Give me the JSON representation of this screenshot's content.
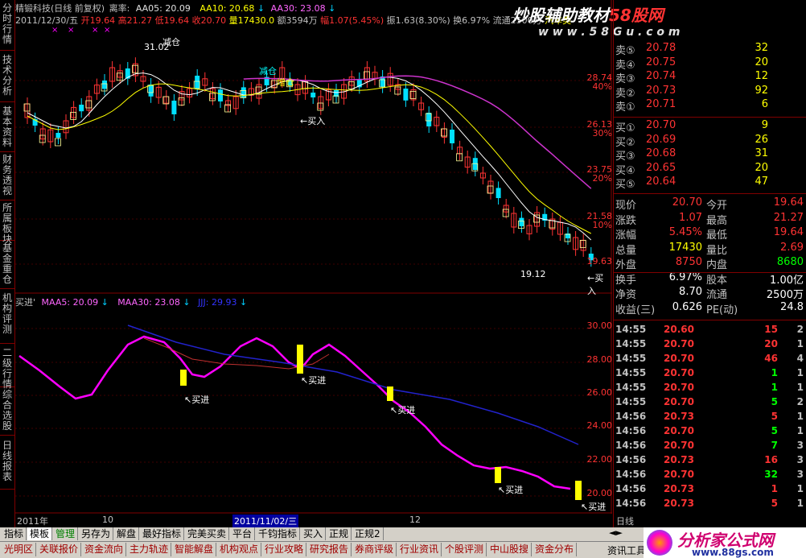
{
  "left_tabs": [
    "分时行情",
    "技术分析",
    "基本资料",
    "财务透视",
    "所属板块",
    "基金重仓",
    "机构评测",
    "二级行情",
    "综合选股",
    "日线报表"
  ],
  "header": {
    "stock": "精锻科技(日线 前复权)",
    "ind_label": "离率:",
    "aa05": "AA05: 20.09",
    "aa10": "AA10: 20.68",
    "aa30": "AA30: 23.08",
    "date": "2011/12/30/五",
    "open": "开19.64",
    "high": "高21.27",
    "low": "低19.64",
    "close": "收20.70",
    "vol": "量17430.0",
    "amt": "额3594万",
    "chg": "幅1.07(5.45%)",
    "amp": "振1.63(8.30%)",
    "turn": "换6.97%",
    "float": "流通2500万",
    "sector": "汽车类",
    "ad_text": "炒股辅助教材",
    "ad_site": "58股网",
    "ad_url": "w w w . 5 8 G u . c o m"
  },
  "price_axis": {
    "labels": [
      {
        "v": "28.74",
        "pct": "40%"
      },
      {
        "v": "26.13",
        "pct": "30%"
      },
      {
        "v": "23.75",
        "pct": "20%"
      },
      {
        "v": "21.58",
        "pct": "10%"
      },
      {
        "v": "19.63",
        "pct": ""
      }
    ]
  },
  "annotations": {
    "reduce1": "减仓",
    "high_label": "31.02",
    "reduce2": "减仓",
    "add": "增仓",
    "buy1": "←买入",
    "low_label": "19.12",
    "buy2": "←买入"
  },
  "lower_header": {
    "name": "买进'",
    "maa5": "MAA5: 20.09",
    "maa30": "MAA30: 23.08",
    "jjj": "JJJ: 29.93"
  },
  "lower_axis": [
    "30.00",
    "28.00",
    "26.00",
    "24.00",
    "22.00",
    "20.00"
  ],
  "buy_labels": [
    "买进",
    "买进",
    "买进",
    "买进",
    "买进"
  ],
  "time_axis": {
    "y2011": "2011年",
    "m10": "10",
    "cursor": "2011/11/02/三",
    "m12": "12",
    "mode": "日线"
  },
  "order_book": {
    "sell": [
      {
        "name": "卖⑤",
        "price": "20.78",
        "vol": "32"
      },
      {
        "name": "卖④",
        "price": "20.75",
        "vol": "20"
      },
      {
        "name": "卖③",
        "price": "20.74",
        "vol": "12"
      },
      {
        "name": "卖②",
        "price": "20.73",
        "vol": "92"
      },
      {
        "name": "卖①",
        "price": "20.71",
        "vol": "6"
      }
    ],
    "buy": [
      {
        "name": "买①",
        "price": "20.70",
        "vol": "9"
      },
      {
        "name": "买②",
        "price": "20.69",
        "vol": "26"
      },
      {
        "name": "买③",
        "price": "20.68",
        "vol": "31"
      },
      {
        "name": "买④",
        "price": "20.65",
        "vol": "20"
      },
      {
        "name": "买⑤",
        "price": "20.64",
        "vol": "47"
      }
    ]
  },
  "quote": [
    {
      "l1": "现价",
      "v1": "20.70",
      "l2": "今开",
      "v2": "19.64"
    },
    {
      "l1": "涨跌",
      "v1": "1.07",
      "l2": "最高",
      "v2": "21.27"
    },
    {
      "l1": "涨幅",
      "v1": "5.45%",
      "l2": "最低",
      "v2": "19.64"
    },
    {
      "l1": "总量",
      "v1": "17430",
      "l2": "量比",
      "v2": "2.69"
    },
    {
      "l1": "外盘",
      "v1": "8750",
      "l2": "内盘",
      "v2": "8680"
    },
    {
      "l1": "换手",
      "v1": "6.97%",
      "l2": "股本",
      "v2": "1.00亿"
    },
    {
      "l1": "净资",
      "v1": "8.70",
      "l2": "流通",
      "v2": "2500万"
    },
    {
      "l1": "收益(三)",
      "v1": "0.626",
      "l2": "PE(动)",
      "v2": "24.8"
    }
  ],
  "ticks": [
    {
      "t": "14:55",
      "p": "20.60",
      "v": "15",
      "n": "2"
    },
    {
      "t": "14:55",
      "p": "20.70",
      "v": "20",
      "n": "1"
    },
    {
      "t": "14:55",
      "p": "20.70",
      "v": "46",
      "n": "4"
    },
    {
      "t": "14:55",
      "p": "20.70",
      "v": "1",
      "n": "1"
    },
    {
      "t": "14:55",
      "p": "20.70",
      "v": "1",
      "n": "1"
    },
    {
      "t": "14:55",
      "p": "20.70",
      "v": "5",
      "n": "2"
    },
    {
      "t": "14:56",
      "p": "20.73",
      "v": "5",
      "n": "1"
    },
    {
      "t": "14:56",
      "p": "20.70",
      "v": "5",
      "n": "1"
    },
    {
      "t": "14:56",
      "p": "20.70",
      "v": "7",
      "n": "3"
    },
    {
      "t": "14:56",
      "p": "20.73",
      "v": "16",
      "n": "3"
    },
    {
      "t": "14:56",
      "p": "20.70",
      "v": "32",
      "n": "3"
    },
    {
      "t": "14:56",
      "p": "20.73",
      "v": "1",
      "n": "1"
    },
    {
      "t": "14:56",
      "p": "20.73",
      "v": "5",
      "n": "1"
    }
  ],
  "bottom_tabs1": [
    "指标",
    "模板",
    "管理",
    "另存为",
    "解盘",
    "最好指标",
    "完美买卖",
    "平台",
    "千钧指标",
    "买入",
    "正规",
    "正规2"
  ],
  "bottom_tabs2": [
    "光明区",
    "关联报价",
    "资金流向",
    "主力轨迹",
    "智能解盘",
    "机构观点",
    "行业攻略",
    "研究报告",
    "券商评级",
    "行业资讯",
    "个股评测",
    "中山股搜",
    "资金分布"
  ],
  "footer_right": "资讯工具",
  "logo": {
    "text": "分析家公式网",
    "url": "www.88gs.com"
  },
  "colors": {
    "up": "#ff3333",
    "down": "#00e0ff",
    "yellow": "#ffff00",
    "magenta": "#ff00ff",
    "panel_border": "#800000"
  }
}
